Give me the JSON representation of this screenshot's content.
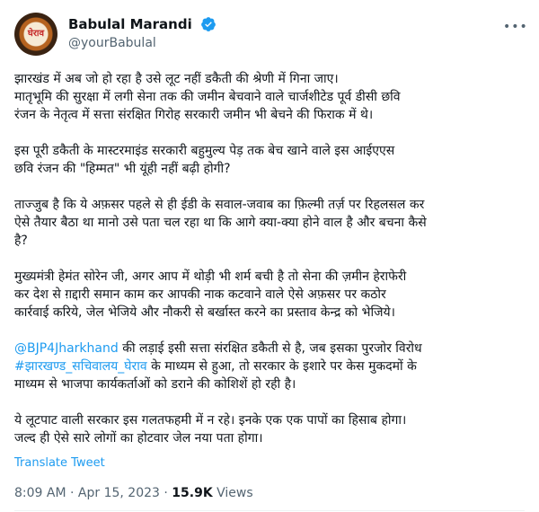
{
  "author": {
    "display_name": "Babulal Marandi",
    "handle": "@yourBabulal",
    "avatar_text": "घेराव",
    "verified": true,
    "verified_color": "#1d9bf0"
  },
  "tweet": {
    "p1_l1": "झारखंड में अब जो हो रहा है उसे लूट नहीं डकैती की श्रेणी में गिना जाए।",
    "p1_l2": "मातृभूमि की सुरक्षा में लगी सेना तक की जमीन बेचवाने वाले चार्जशीटेड पूर्व डीसी छवि",
    "p1_l3": "रंजन के नेतृत्व में सत्ता संरक्षित गिरोह सरकारी जमीन भी बेचने की फिराक में थे।",
    "p2_l1": "इस पूरी डकैती के मास्टरमाइंड सरकारी बहुमुल्य पेड़ तक बेच खाने वाले इस आईएएस",
    "p2_l2": "छवि रंजन की \"हिम्मत\" भी यूंही नहीं बढ़ी होगी?",
    "p3_l1": "ताज्जुब है कि ये अफ़सर पहले से ही ईडी के सवाल-जवाब का फ़िल्मी तर्ज़ पर रिहलसल कर",
    "p3_l2": "ऐसे तैयार बैठा था मानो उसे पता चल रहा था कि आगे क्या-क्या होने वाल है और बचना कैसे",
    "p3_l3": "है?",
    "p4_l1": "मुख्यमंत्री हेमंत सोरेन जी, अगर आप में थोड़ी भी शर्म बची है तो सेना की ज़मीन हेराफेरी",
    "p4_l2": "कर देश से ग़द्दारी समान काम कर आपकी नाक कटवाने वाले ऐसे अफ़सर पर कठोर",
    "p4_l3": "कार्रवाई करिये, जेल भेजिये और नौकरी से बर्खास्त करने का प्रस्ताव केन्द्र को भेजिये।",
    "p5_mention": "@BJP4Jharkhand",
    "p5_l1_rest": " की लड़ाई इसी सत्ता संरक्षित डकैती से है, जब इसका पुरजोर विरोध",
    "p5_hashtag": "#झारखण्ड_सचिवालय_घेराव",
    "p5_l2_rest": " के माध्यम से हुआ, तो सरकार के इशारे पर केस मुकदमों के",
    "p5_l3": "माध्यम से भाजपा कार्यकर्ताओं को डराने की कोशिशें हो रही है।",
    "p6_l1": "ये लूटपाट वाली सरकार इस गलतफहमी में न रहे। इनके एक एक पापों का हिसाब होगा।",
    "p6_l2": "जल्द ही ऐसे सारे लोगों का होटवार जेल नया पता होगा।"
  },
  "translate_label": "Translate Tweet",
  "meta": {
    "time": "8:09 AM",
    "separator": " · ",
    "date": "Apr 15, 2023",
    "views_count": "15.9K",
    "views_label": " Views"
  },
  "colors": {
    "text": "#0f1419",
    "secondary": "#536471",
    "link": "#1d9bf0"
  }
}
